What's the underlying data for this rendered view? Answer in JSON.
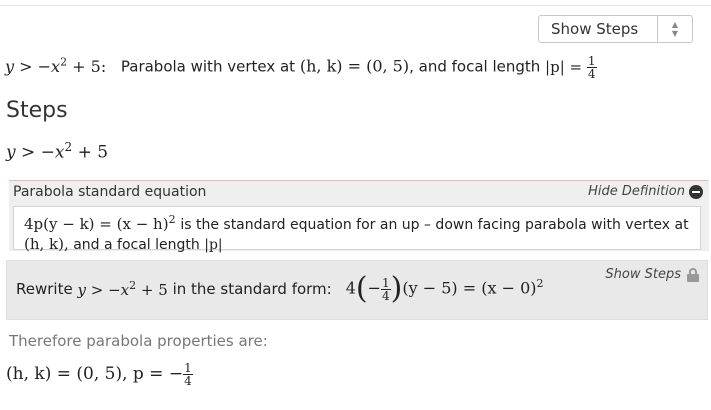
{
  "toolbar": {
    "show_steps_select": "Show Steps"
  },
  "summary": {
    "inequality_y": "y",
    "inequality_rel": ">",
    "inequality_rhs_a": "−x",
    "inequality_exp": "2",
    "inequality_rhs_b": "+ 5:",
    "text_a": "Parabola with vertex at",
    "vertex_eq": "(h, k) = (0, 5)",
    "text_b": ", and focal length",
    "focal_lhs": "|p| =",
    "focal_num": "1",
    "focal_den": "4"
  },
  "steps": {
    "heading": "Steps",
    "eq_y": "y",
    "eq_rel": ">",
    "eq_rhs_a": "−x",
    "eq_exp": "2",
    "eq_rhs_b": "+ 5"
  },
  "definition": {
    "title": "Parabola standard equation",
    "toggle_label": "Hide Definition",
    "eq_main": "4p(y − k) = (x − h)",
    "eq_exp": "2",
    "text_a": "is the standard equation for an up – down facing parabola with vertex at",
    "vertex": "(h, k),",
    "text_b": "and a focal length",
    "focal": "|p|"
  },
  "rewrite": {
    "prefix": "Rewrite",
    "ineq_y": "y >",
    "ineq_rhs": "−x",
    "ineq_exp": "2",
    "ineq_tail": "+ 5",
    "suffix": "in the standard form:",
    "eq_four": "4",
    "frac_sign": "−",
    "frac_num": "1",
    "frac_den": "4",
    "eq_middle": "(y − 5) = (x − 0)",
    "eq_exp": "2",
    "show_steps_label": "Show Steps"
  },
  "properties": {
    "label": "Therefore parabola properties are:",
    "eq_main": "(h, k) = (0, 5), p =",
    "p_sign": "−",
    "p_num": "1",
    "p_den": "4"
  },
  "icons": {
    "select": "chevron-up-down-icon",
    "hide": "minus-circle-icon",
    "locked": "lock-icon"
  }
}
